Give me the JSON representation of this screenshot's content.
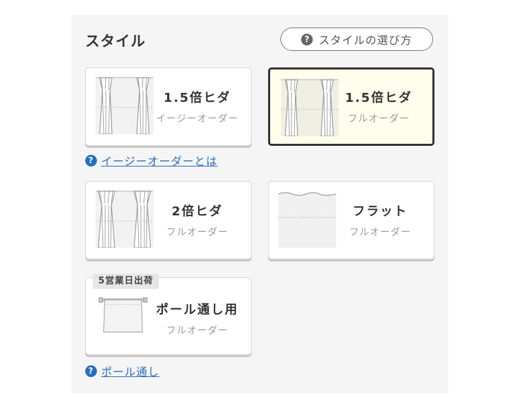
{
  "section": {
    "title": "スタイル",
    "guide_label": "スタイルの選び方",
    "help_icon": "?"
  },
  "styles": [
    {
      "name": "1.5倍ヒダ",
      "sub": "イージーオーダー",
      "icon": "pleat-curtain-icon",
      "selected": false
    },
    {
      "name": "1.5倍ヒダ",
      "sub": "フルオーダー",
      "icon": "pleat-curtain-icon",
      "selected": true
    },
    {
      "name": "2倍ヒダ",
      "sub": "フルオーダー",
      "icon": "double-pleat-curtain-icon",
      "selected": false
    },
    {
      "name": "フラット",
      "sub": "フルオーダー",
      "icon": "flat-curtain-icon",
      "selected": false
    },
    {
      "name": "ポール通し用",
      "sub": "フルオーダー",
      "icon": "pole-pocket-curtain-icon",
      "selected": false,
      "badge": "5営業日出荷"
    }
  ],
  "links": {
    "easy_order": "イージーオーダーとは",
    "pole": "ポール通し"
  },
  "colors": {
    "panel": "#f5f5f5",
    "selected_bg": "#fffeec",
    "selected_border": "#333333",
    "link": "#2a6ebb"
  }
}
